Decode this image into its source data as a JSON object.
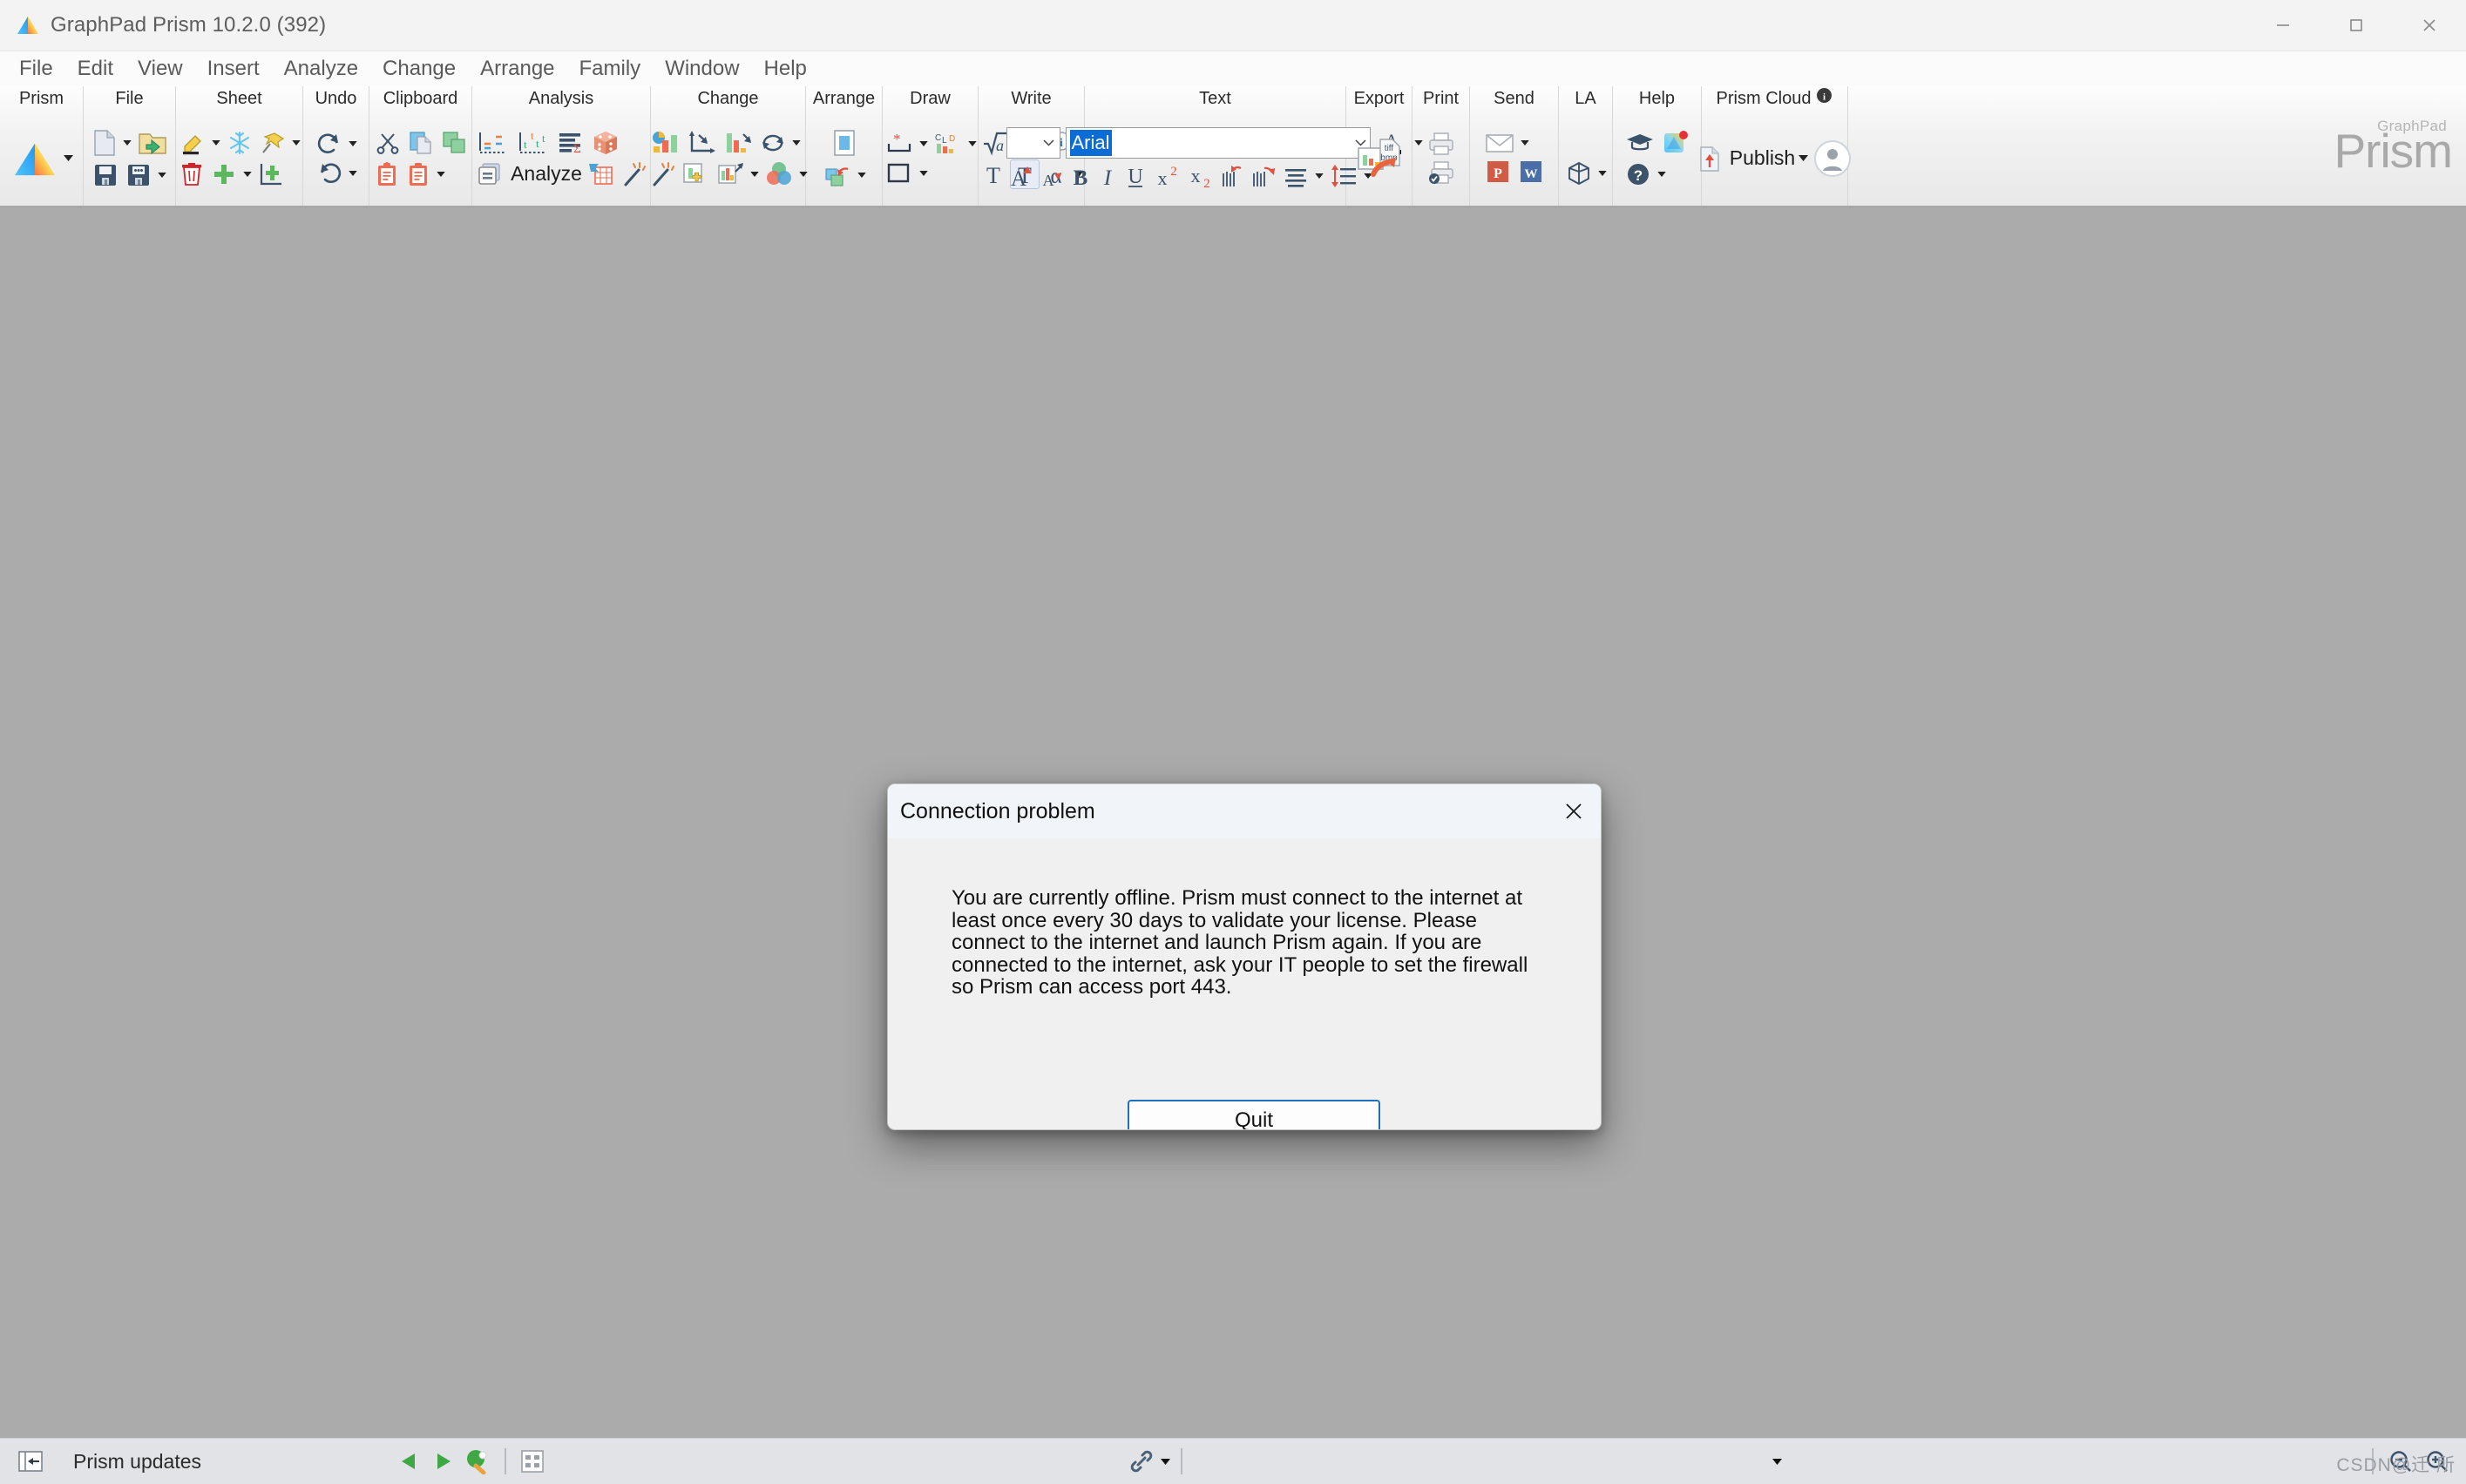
{
  "window": {
    "title": "GraphPad Prism 10.2.0 (392)",
    "app_icon": "prism-triangle-icon",
    "controls": {
      "minimize": "minimize-icon",
      "maximize": "maximize-icon",
      "close": "close-icon"
    }
  },
  "menubar": {
    "items": [
      {
        "label": "File"
      },
      {
        "label": "Edit"
      },
      {
        "label": "View"
      },
      {
        "label": "Insert"
      },
      {
        "label": "Analyze"
      },
      {
        "label": "Change"
      },
      {
        "label": "Arrange"
      },
      {
        "label": "Family"
      },
      {
        "label": "Window"
      },
      {
        "label": "Help"
      }
    ]
  },
  "ribbon": {
    "groups": [
      {
        "title": "Prism",
        "icons": [
          "prism-triangle-icon"
        ]
      },
      {
        "title": "File",
        "icons": [
          "new-file-icon",
          "open-folder-icon",
          "save-icon",
          "save-as-icon"
        ]
      },
      {
        "title": "Sheet",
        "icons": [
          "highlighter-icon",
          "freeze-snowflake-icon",
          "pin-icon",
          "delete-trash-icon",
          "add-plus-icon",
          "new-graph-icon"
        ]
      },
      {
        "title": "Undo",
        "icons": [
          "redo-icon",
          "undo-icon"
        ]
      },
      {
        "title": "Clipboard",
        "icons": [
          "cut-scissors-icon",
          "copy-icon",
          "duplicate-icon",
          "paste-icon",
          "paste-special-icon"
        ]
      },
      {
        "title": "Analysis",
        "icons": [
          "interpolate-icon",
          "t-test-icon",
          "summary-sigma-icon",
          "simulate-dice-icon",
          "analyze-icon",
          "analyze-grid-icon",
          "magic-wand-icon"
        ],
        "analyze_label": "Analyze"
      },
      {
        "title": "Change",
        "icons": [
          "graph-type-icon",
          "axes-icon",
          "data-sets-icon",
          "refresh-icon",
          "magic-wand-icon",
          "add-graph-icon",
          "resize-graph-icon",
          "color-scheme-icon"
        ]
      },
      {
        "title": "Arrange",
        "icons": [
          "frame-icon",
          "send-backward-icon"
        ]
      },
      {
        "title": "Draw",
        "icons": [
          "asterisk-bracket-icon",
          "clipboard-legend-icon",
          "rectangle-icon"
        ]
      },
      {
        "title": "Write",
        "icons": [
          "equation-icon",
          "word-embed-icon",
          "info-plus-icon",
          "text-icon",
          "text-box-icon",
          "greek-alpha-icon"
        ]
      },
      {
        "title": "Text",
        "icons": [
          "font-size-select",
          "font-name-input",
          "font-grow-icon",
          "font-shrink-icon",
          "bold-icon",
          "italic-icon",
          "underline-icon",
          "superscript-icon",
          "subscript-icon",
          "rotate-left-icon",
          "rotate-right-icon",
          "align-icon",
          "line-spacing-icon",
          "font-color-icon"
        ]
      },
      {
        "title": "Export",
        "icons": [
          "export-tiff-bmp-icon"
        ]
      },
      {
        "title": "Print",
        "icons": [
          "print-icon",
          "print-preview-icon"
        ]
      },
      {
        "title": "Send",
        "icons": [
          "email-icon",
          "powerpoint-icon",
          "word-icon"
        ]
      },
      {
        "title": "LA",
        "icons": [
          "cube-icon"
        ]
      },
      {
        "title": "Help",
        "icons": [
          "graduation-cap-icon",
          "whats-new-icon",
          "question-icon"
        ]
      },
      {
        "title": "Prism Cloud",
        "icons": [
          "info-icon",
          "publish-icon",
          "account-avatar-icon"
        ],
        "publish_label": "Publish",
        "info_badge": "info-icon"
      }
    ],
    "text_group": {
      "font_size_value": "",
      "font_name_value": "Arial",
      "font_size_placeholder": ""
    },
    "prism_cloud": {
      "title": "Prism Cloud",
      "publish_label": "Publish"
    },
    "wordmark": {
      "brand_small": "GraphPad",
      "brand_main": "Prism"
    }
  },
  "dialog": {
    "title": "Connection problem",
    "close_icon": "close-icon",
    "message": "You are currently offline. Prism must connect to the internet at least once every 30 days to validate your license. Please connect to the internet and launch Prism again. If you are connected to the internet, ask your IT people to set the firewall so Prism can access port 443.",
    "primary_button": "Quit"
  },
  "statusbar": {
    "collapse_icon": "collapse-panel-icon",
    "label": "Prism updates",
    "prev_icon": "prev-sheet-icon",
    "next_icon": "next-sheet-icon",
    "find_icon": "find-paddle-icon",
    "sheets_icon": "sheet-grid-icon",
    "link_icon": "link-icon",
    "more_icon": "chevron-down-icon",
    "zoom_out_icon": "zoom-out-icon",
    "zoom_in_icon": "zoom-in-icon",
    "watermark": "CSDN@迁 所"
  },
  "colors": {
    "canvas": "#ababab",
    "ribbon_bg": "#f2f2f2",
    "accent_blue": "#1f6fbf",
    "selection_blue": "#0a6cd4",
    "statusbar_bg": "#e1e3e6",
    "dialog_bg": "#f0f0f0",
    "dialog_header": "#f1f4f8"
  }
}
